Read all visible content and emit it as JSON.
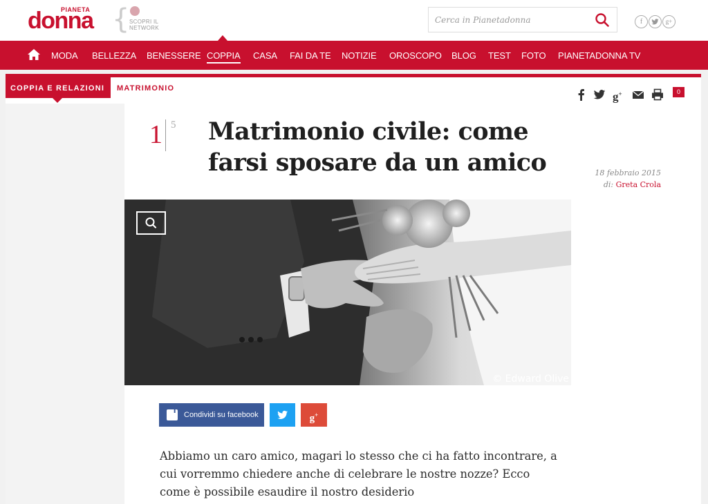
{
  "header": {
    "logo_small": "PIANETA",
    "logo_big": "donna",
    "network_line1": "SCOPRI IL",
    "network_line2": "NETWORK",
    "search_placeholder": "Cerca in Pianetadonna",
    "social_icons": [
      "facebook-icon",
      "twitter-icon",
      "google-plus-icon"
    ]
  },
  "nav": {
    "items": [
      {
        "label": "MODA"
      },
      {
        "label": "BELLEZZA"
      },
      {
        "label": "BENESSERE"
      },
      {
        "label": "COPPIA"
      },
      {
        "label": "CASA"
      },
      {
        "label": "FAI DA TE"
      },
      {
        "label": "NOTIZIE"
      },
      {
        "label": "OROSCOPO"
      },
      {
        "label": "BLOG"
      },
      {
        "label": "TEST"
      },
      {
        "label": "FOTO"
      },
      {
        "label": "PIANETADONNA TV"
      }
    ],
    "active": "COPPIA"
  },
  "breadcrumb": {
    "section": "COPPIA E RELAZIONI",
    "sub": "MATRIMONIO"
  },
  "share_top": {
    "icons": [
      "facebook-icon",
      "twitter-icon",
      "google-plus-icon",
      "mail-icon",
      "print-icon",
      "comments-icon"
    ],
    "comment_count": "0"
  },
  "article": {
    "counter_current": "1",
    "counter_total": "5",
    "title": "Matrimonio civile: come farsi sposare da un amico",
    "date": "18 febbraio 2015",
    "by_label": "di:",
    "author": "Greta Crola",
    "image_credit": "© Edward Olive",
    "lead": "Abbiamo un caro amico, magari lo stesso che ci ha fatto incontrare, a cui vorremmo chiedere anche di celebrare le nostre nozze? Ecco come è possibile esaudire il nostro desiderio"
  },
  "share_buttons": {
    "facebook_label": "Condividi su facebook"
  },
  "colors": {
    "brand_red": "#c8102e",
    "facebook": "#3b5998",
    "twitter": "#1da1f2",
    "google_plus": "#dd4b39"
  }
}
